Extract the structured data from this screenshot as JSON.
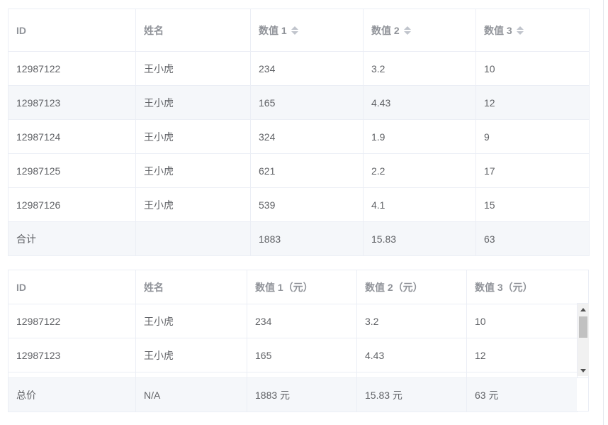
{
  "table1": {
    "headers": [
      "ID",
      "姓名",
      "数值 1",
      "数值 2",
      "数值 3"
    ],
    "rows": [
      [
        "12987122",
        "王小虎",
        "234",
        "3.2",
        "10"
      ],
      [
        "12987123",
        "王小虎",
        "165",
        "4.43",
        "12"
      ],
      [
        "12987124",
        "王小虎",
        "324",
        "1.9",
        "9"
      ],
      [
        "12987125",
        "王小虎",
        "621",
        "2.2",
        "17"
      ],
      [
        "12987126",
        "王小虎",
        "539",
        "4.1",
        "15"
      ]
    ],
    "summary": [
      "合计",
      "",
      "1883",
      "15.83",
      "63"
    ]
  },
  "table2": {
    "headers": [
      "ID",
      "姓名",
      "数值 1（元）",
      "数值 2（元）",
      "数值 3（元）"
    ],
    "rows": [
      [
        "12987122",
        "王小虎",
        "234",
        "3.2",
        "10"
      ],
      [
        "12987123",
        "王小虎",
        "165",
        "4.43",
        "12"
      ]
    ],
    "summary": [
      "总价",
      "N/A",
      "1883 元",
      "15.83 元",
      "63 元"
    ]
  }
}
